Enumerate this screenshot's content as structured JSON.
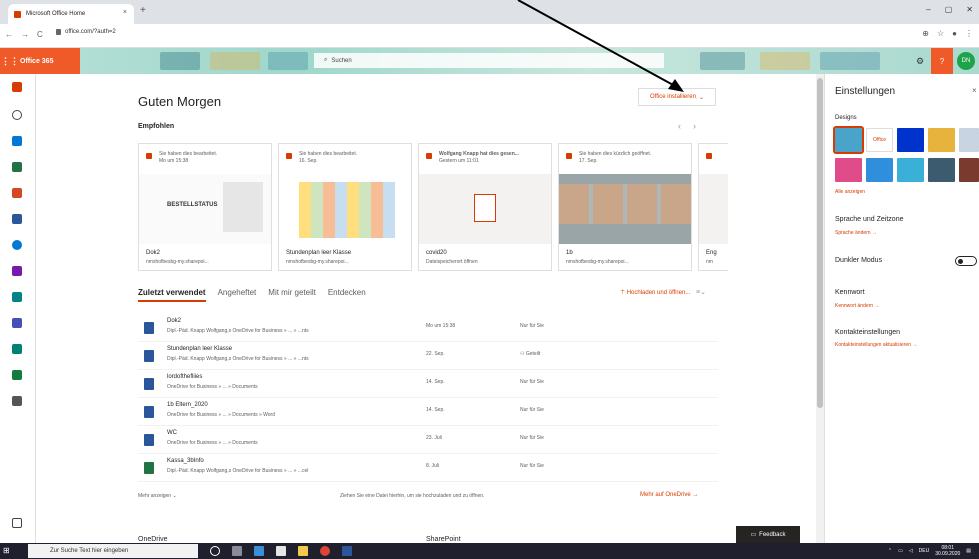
{
  "browser": {
    "tab_title": "Microsoft Office Home",
    "tab_close": "×",
    "new_tab": "+",
    "url": "office.com/?auth=2",
    "window_controls": [
      "–",
      "▢",
      "✕"
    ]
  },
  "header": {
    "brand": "Office 365",
    "search_placeholder": "Suchen",
    "help": "?",
    "avatar_initials": "DN"
  },
  "main": {
    "greeting": "Guten Morgen",
    "install_button": "Office installieren",
    "recommended_label": "Empfohlen",
    "cards": [
      {
        "activity": "Sie haben dies bearbeitet.",
        "when": "Mo um 15:38",
        "name": "Dok2",
        "path": "nmshofbesbg-my.sharepoi..."
      },
      {
        "activity": "Sie haben dies bearbeitet.",
        "when": "16. Sep.",
        "name": "Stundenplan leer Klasse",
        "path": "nmshofbesbg-my.sharepoi..."
      },
      {
        "activity": "Wolfgang Knapp hat dies gesen...",
        "when": "Gestern um 11:01",
        "name": "covid20",
        "path": "Dateispeicherort öffnen"
      },
      {
        "activity": "Sie haben dies kürzlich geöffnet.",
        "when": "17. Sep.",
        "name": "1b",
        "path": "nmshofbesbg-my.sharepoi..."
      },
      {
        "activity": "",
        "when": "",
        "name": "Eng",
        "path": "nm"
      }
    ],
    "card_thumb_text": "BESTELLSTATUS",
    "tabs": [
      "Zuletzt verwendet",
      "Angeheftet",
      "Mit mir geteilt",
      "Entdecken"
    ],
    "upload_label": "Hochladen und öffnen...",
    "files": [
      {
        "name": "Dok2",
        "path": "Dipl.-Päd. Knapp Wolfgang,s OneDrive for Business » ... » ...nts",
        "date": "Mo um 15:38",
        "sharing": "Nur für Sie",
        "color": "#2b579a"
      },
      {
        "name": "Stundenplan leer Klasse",
        "path": "Dipl.-Päd. Knapp Wolfgang,s OneDrive for Business » ... » ...nts",
        "date": "22. Sep.",
        "sharing": "Geteilt",
        "color": "#2b579a"
      },
      {
        "name": "lordofthefliies",
        "path": "OneDrive for Business » ... » Documents",
        "date": "14. Sep.",
        "sharing": "Nur für Sie",
        "color": "#2b579a"
      },
      {
        "name": "1b Eltern_2020",
        "path": "OneDrive for Business » ... » Documents » Word",
        "date": "14. Sep.",
        "sharing": "Nur für Sie",
        "color": "#2b579a"
      },
      {
        "name": "WC",
        "path": "OneDrive for Business » ... » Documents",
        "date": "23. Juli",
        "sharing": "Nur für Sie",
        "color": "#2b579a"
      },
      {
        "name": "Kassa_3bInfo",
        "path": "Dipl.-Päd. Knapp Wolfgang,s OneDrive for Business » ... » ...cel",
        "date": "8. Juli",
        "sharing": "Nur für Sie",
        "color": "#217346"
      }
    ],
    "more_label": "Mehr anzeigen",
    "drop_note": "Ziehen Sie eine Datei hierhin, um sie hochzuladen und zu öffnen.",
    "more_onedrive": "Mehr auf OneDrive",
    "onedrive_heading": "OneDrive",
    "sharepoint_heading": "SharePoint",
    "feedback": "Feedback"
  },
  "settings": {
    "title": "Einstellungen",
    "close": "×",
    "designs_label": "Designs",
    "office_theme_label": "Office",
    "show_all": "Alle anzeigen",
    "language_heading": "Sprache und Zeitzone",
    "language_link": "Sprache ändern",
    "dark_mode": "Dunkler Modus",
    "password_heading": "Kennwort",
    "password_link": "Kennwort ändern",
    "contact_heading": "Kontakteinstellungen",
    "contact_link": "Kontakteinstellungen aktualisieren"
  },
  "taskbar": {
    "search_placeholder": "Zur Suche Text hier eingeben",
    "language": "DEU",
    "time": "08:01",
    "date": "30.09.2020"
  },
  "colors": {
    "accent": "#d83b01",
    "brand": "#f05a28",
    "header_bg": "#b9e1d8"
  }
}
